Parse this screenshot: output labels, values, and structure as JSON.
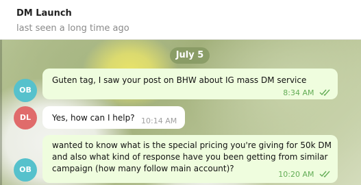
{
  "header": {
    "title": "DM Launch",
    "status": "last seen a long time ago"
  },
  "chat": {
    "date_separator": "July 5",
    "messages": [
      {
        "sender_initials": "OB",
        "direction": "outgoing",
        "text": "Guten tag, I saw your post on BHW about IG mass DM service",
        "time": "8:34 AM",
        "status_icon": "double-check-icon"
      },
      {
        "sender_initials": "DL",
        "direction": "incoming",
        "text": "Yes, how can I help?",
        "time": "10:14 AM"
      },
      {
        "sender_initials": "OB",
        "direction": "outgoing",
        "lines": [
          "wanted to know what is the special pricing you're giving for 50k DM",
          "and also what kind of response have you been getting from similar",
          "campaign (how many follow main account)?"
        ],
        "time": "10:20 AM",
        "status_icon": "double-check-icon"
      }
    ]
  },
  "colors": {
    "avatar_ob": "#56c1cc",
    "avatar_dl": "#e06b6b",
    "outgoing_bubble": "#effdde",
    "incoming_bubble": "#ffffff",
    "time_outgoing": "#62ac55",
    "date_pill": "#82965f"
  }
}
